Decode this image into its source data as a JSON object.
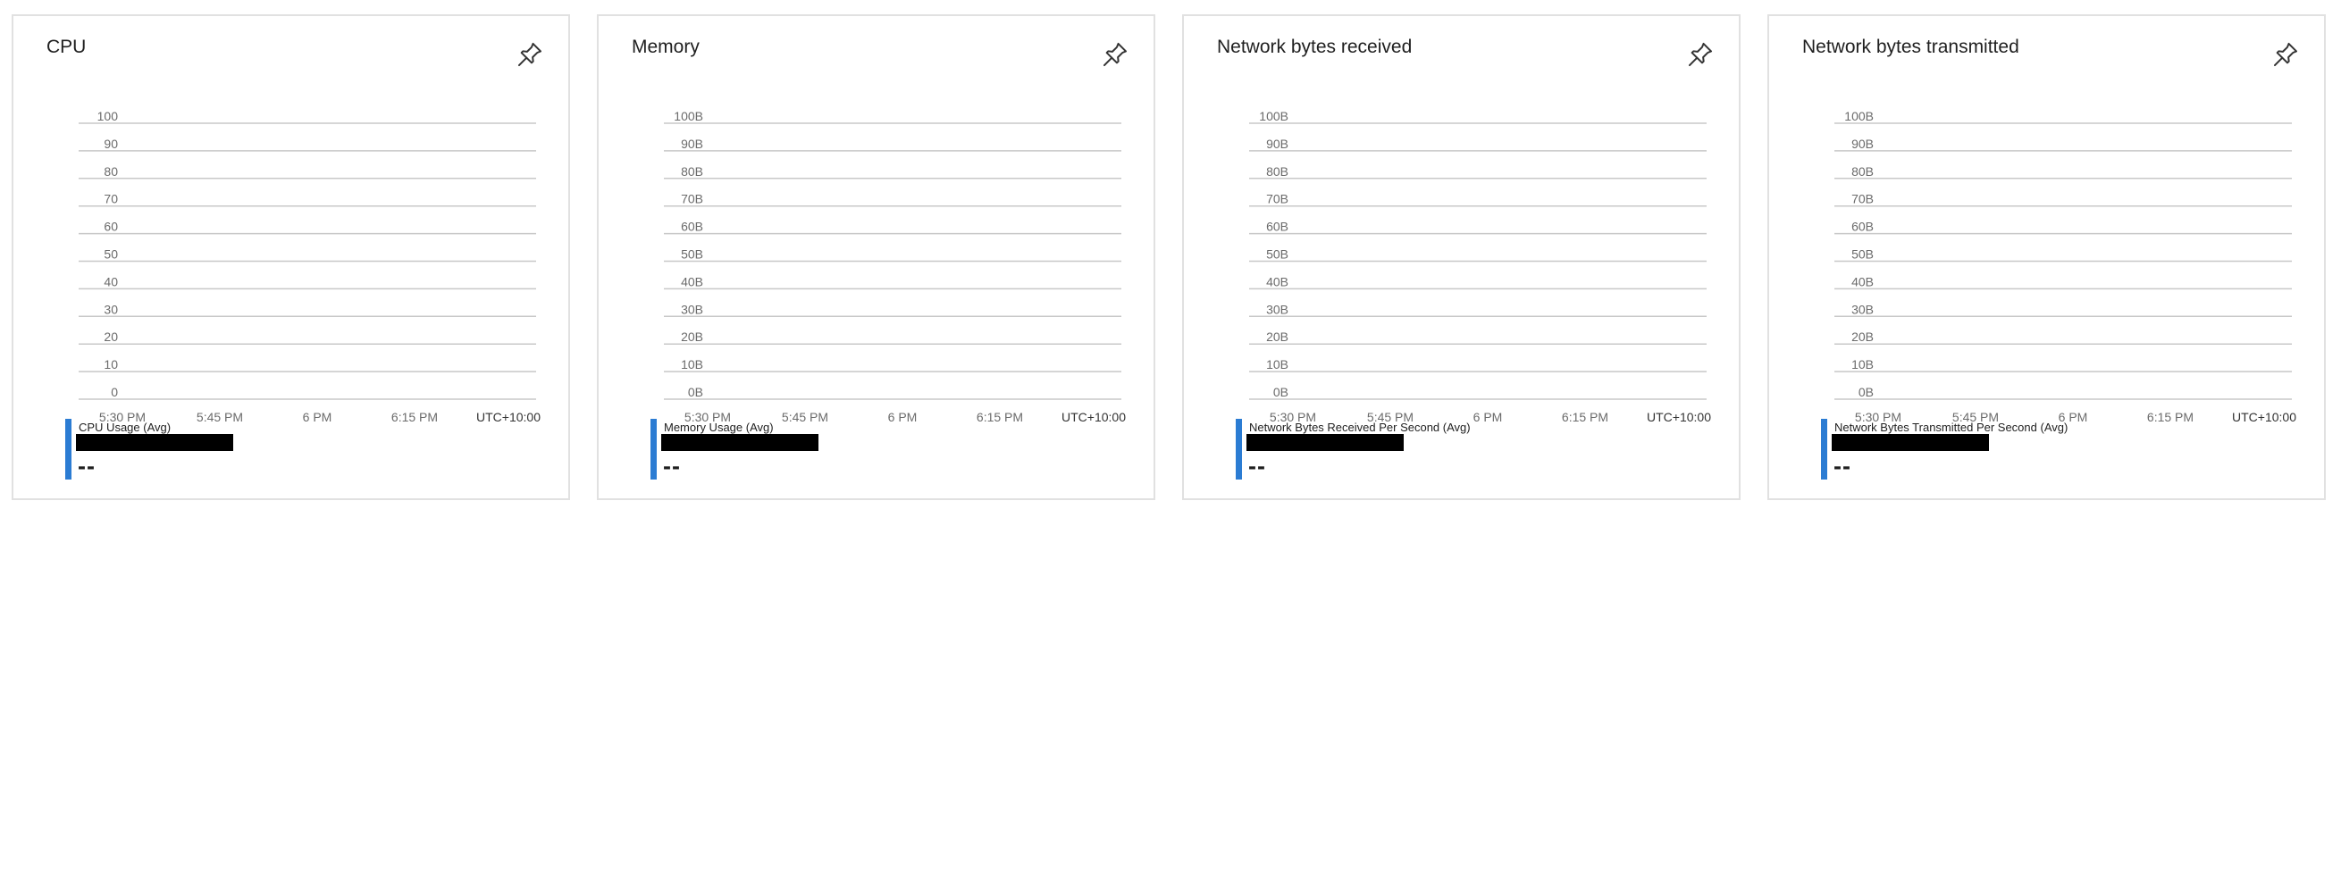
{
  "x_ticks": [
    "5:30 PM",
    "5:45 PM",
    "6 PM",
    "6:15 PM"
  ],
  "timezone": "UTC+10:00",
  "accent_color": "#2b7cd3",
  "tiles": [
    {
      "title": "CPU",
      "pin_icon": "pin-icon",
      "y_ticks": [
        "100",
        "90",
        "80",
        "70",
        "60",
        "50",
        "40",
        "30",
        "20",
        "10",
        "0"
      ],
      "legend_label": "CPU Usage (Avg)",
      "legend_value": "--"
    },
    {
      "title": "Memory",
      "pin_icon": "pin-icon",
      "y_ticks": [
        "100B",
        "90B",
        "80B",
        "70B",
        "60B",
        "50B",
        "40B",
        "30B",
        "20B",
        "10B",
        "0B"
      ],
      "legend_label": "Memory Usage (Avg)",
      "legend_value": "--"
    },
    {
      "title": "Network bytes received",
      "pin_icon": "pin-icon",
      "y_ticks": [
        "100B",
        "90B",
        "80B",
        "70B",
        "60B",
        "50B",
        "40B",
        "30B",
        "20B",
        "10B",
        "0B"
      ],
      "legend_label": "Network Bytes Received Per Second (Avg)",
      "legend_value": "--"
    },
    {
      "title": "Network bytes transmitted",
      "pin_icon": "pin-icon",
      "y_ticks": [
        "100B",
        "90B",
        "80B",
        "70B",
        "60B",
        "50B",
        "40B",
        "30B",
        "20B",
        "10B",
        "0B"
      ],
      "legend_label": "Network Bytes Transmitted Per Second (Avg)",
      "legend_value": "--"
    }
  ]
}
